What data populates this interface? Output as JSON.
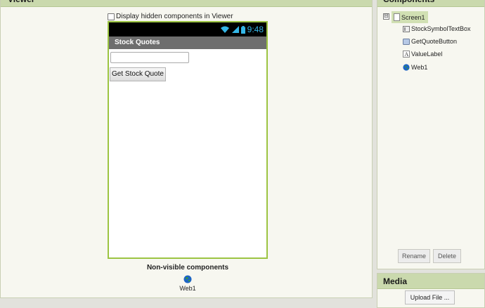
{
  "viewer": {
    "title": "Viewer",
    "hidden_components_label": "Display hidden components in Viewer",
    "phone": {
      "time": "9:48",
      "app_title": "Stock Quotes",
      "textbox_value": "",
      "button_label": "Get Stock Quote"
    },
    "nonvisible_title": "Non-visible components",
    "nonvisible_items": [
      "Web1"
    ]
  },
  "components": {
    "title": "Components",
    "tree_toggle": "⊟",
    "screen": "Screen1",
    "children": [
      {
        "label": "StockSymbolTextBox",
        "icon": "textbox-icon"
      },
      {
        "label": "GetQuoteButton",
        "icon": "button-icon"
      },
      {
        "label": "ValueLabel",
        "icon": "label-icon"
      },
      {
        "label": "Web1",
        "icon": "globe-icon"
      }
    ],
    "rename_label": "Rename",
    "delete_label": "Delete"
  },
  "media": {
    "title": "Media",
    "upload_label": "Upload File ..."
  },
  "colors": {
    "header": "#cad9ad",
    "phone_border": "#9cc442",
    "time": "#35b6e6",
    "titlebar": "#6e6e6e"
  }
}
